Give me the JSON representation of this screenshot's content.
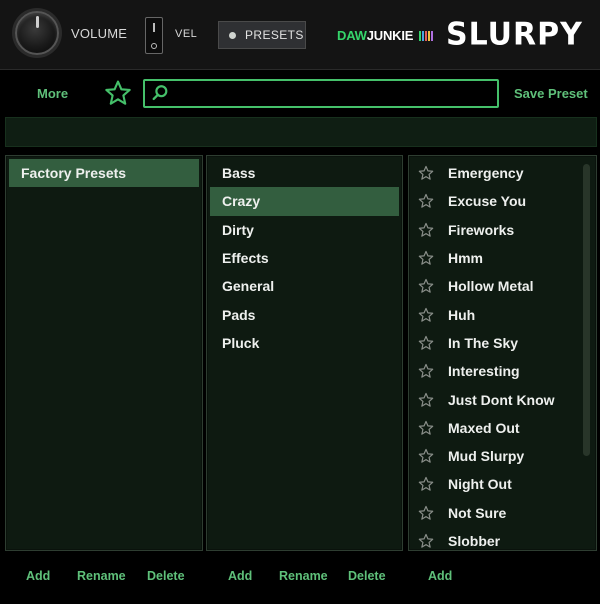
{
  "header": {
    "volume_label": "VOLUME",
    "vel_label": "VEL",
    "presets_label": "PRESETS",
    "brand_daw": "DAW",
    "brand_junkie": "JUNKIE",
    "logo": "SLURPY",
    "brand_bar_colors": [
      "#35d46a",
      "#4aa3df",
      "#e05a5a",
      "#f0c040",
      "#b070e0"
    ]
  },
  "toolbar": {
    "more_label": "More",
    "save_label": "Save Preset",
    "search_value": "",
    "search_placeholder": ""
  },
  "banks": {
    "items": [
      "Factory Presets"
    ],
    "selected": 0
  },
  "categories": {
    "items": [
      "Bass",
      "Crazy",
      "Dirty",
      "Effects",
      "General",
      "Pads",
      "Pluck"
    ],
    "selected": 1
  },
  "presets": {
    "items": [
      "Emergency",
      "Excuse You",
      "Fireworks",
      "Hmm",
      "Hollow Metal",
      "Huh",
      "In The Sky",
      "Interesting",
      "Just Dont Know",
      "Maxed Out",
      "Mud Slurpy",
      "Night Out",
      "Not Sure",
      "Slobber"
    ]
  },
  "actions": {
    "banks": {
      "add": "Add",
      "rename": "Rename",
      "delete": "Delete"
    },
    "categories": {
      "add": "Add",
      "rename": "Rename",
      "delete": "Delete"
    },
    "presets": {
      "add": "Add"
    }
  },
  "colors": {
    "accent": "#45c06a",
    "selected_row": "#335e3f",
    "panel_bg": "#0e1a11"
  }
}
